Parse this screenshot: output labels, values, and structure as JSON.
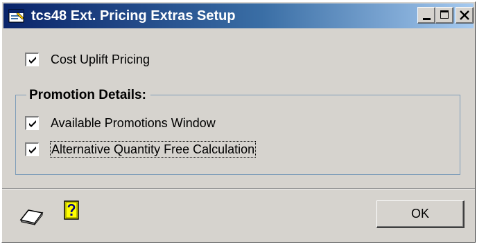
{
  "window": {
    "title": "tcs48 Ext. Pricing Extras Setup"
  },
  "options": {
    "cost_uplift": {
      "label": "Cost Uplift Pricing",
      "checked": true
    }
  },
  "promotion_group": {
    "title": "Promotion Details:",
    "items": [
      {
        "label": "Available Promotions Window",
        "checked": true
      },
      {
        "label": "Alternative Quantity Free Calculation",
        "checked": true
      }
    ]
  },
  "footer": {
    "ok_label": "OK",
    "icons": [
      "note-icon",
      "help-icon"
    ]
  },
  "colors": {
    "titlebar_start": "#0a246a",
    "titlebar_end": "#a6caf0",
    "window_face": "#d6d3ce",
    "group_border": "#7f9db9",
    "help_icon_fill": "#ffff00"
  }
}
